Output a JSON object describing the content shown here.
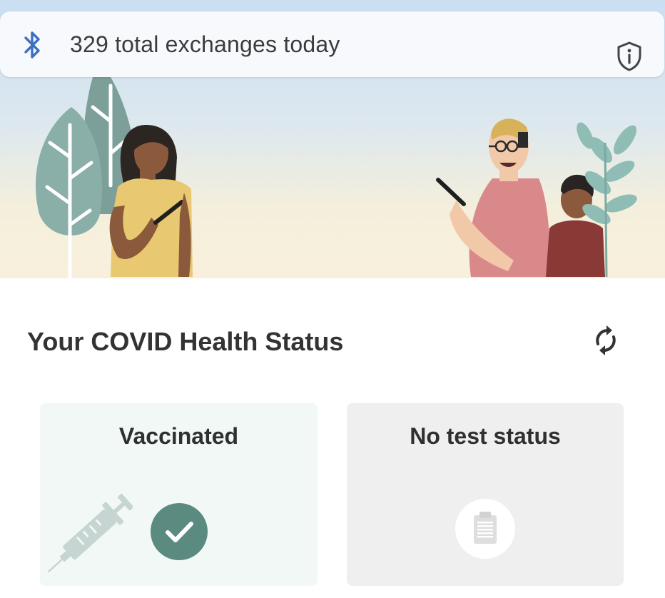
{
  "exposure": {
    "text": "329 total exchanges today",
    "count": 329,
    "icon": "bluetooth-icon",
    "info_icon": "shield-info-icon",
    "accent": "#3d6fc2"
  },
  "status": {
    "title": "Your COVID Health Status",
    "refresh_icon": "refresh-icon"
  },
  "cards": {
    "vaccination": {
      "label": "Vaccinated",
      "icon": "check-icon",
      "decor_icon": "syringe-icon",
      "color": "#5a8a80",
      "background": "#f1f8f6"
    },
    "test": {
      "label": "No test status",
      "icon": "clipboard-icon",
      "background": "#efefef"
    }
  }
}
